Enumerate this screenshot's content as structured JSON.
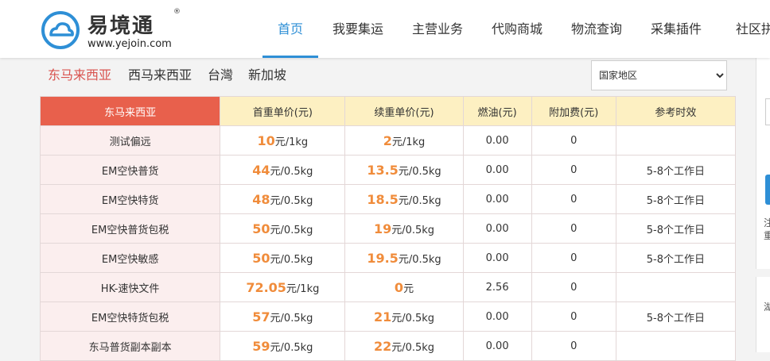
{
  "header": {
    "logo_name": "易境通",
    "logo_reg": "®",
    "logo_url": "www.yejoin.com",
    "nav": [
      {
        "label": "首页",
        "active": true
      },
      {
        "label": "我要集运",
        "active": false
      },
      {
        "label": "主营业务",
        "active": false
      },
      {
        "label": "代购商城",
        "active": false
      },
      {
        "label": "物流查询",
        "active": false
      },
      {
        "label": "采集插件",
        "active": false
      },
      {
        "label": "社区拼团",
        "active": false
      }
    ]
  },
  "regions": {
    "tabs": [
      {
        "label": "东马来西亚",
        "active": true
      },
      {
        "label": "西马来西亚",
        "active": false
      },
      {
        "label": "台灣",
        "active": false
      },
      {
        "label": "新加坡",
        "active": false
      }
    ],
    "select_value": "国家地区"
  },
  "table": {
    "headers": [
      "东马来西亚",
      "首重单价(元)",
      "续重单价(元)",
      "燃油(元)",
      "附加费(元)",
      "参考时效"
    ],
    "rows": [
      {
        "name": "测试偏远",
        "first_price": "10",
        "first_unit": "元/1kg",
        "cont_price": "2",
        "cont_unit": "元/1kg",
        "fuel": "0.00",
        "surcharge": "0",
        "timing": ""
      },
      {
        "name": "EM空快普货",
        "first_price": "44",
        "first_unit": "元/0.5kg",
        "cont_price": "13.5",
        "cont_unit": "元/0.5kg",
        "fuel": "0.00",
        "surcharge": "0",
        "timing": "5-8个工作日"
      },
      {
        "name": "EM空快特货",
        "first_price": "48",
        "first_unit": "元/0.5kg",
        "cont_price": "18.5",
        "cont_unit": "元/0.5kg",
        "fuel": "0.00",
        "surcharge": "0",
        "timing": "5-8个工作日"
      },
      {
        "name": "EM空快普货包税",
        "first_price": "50",
        "first_unit": "元/0.5kg",
        "cont_price": "19",
        "cont_unit": "元/0.5kg",
        "fuel": "0.00",
        "surcharge": "0",
        "timing": "5-8个工作日"
      },
      {
        "name": "EM空快敏感",
        "first_price": "50",
        "first_unit": "元/0.5kg",
        "cont_price": "19.5",
        "cont_unit": "元/0.5kg",
        "fuel": "0.00",
        "surcharge": "0",
        "timing": "5-8个工作日"
      },
      {
        "name": "HK-速快文件",
        "first_price": "72.05",
        "first_unit": "元/1kg",
        "cont_price": "0",
        "cont_unit": "元",
        "fuel": "2.56",
        "surcharge": "0",
        "timing": ""
      },
      {
        "name": "EM空快特货包税",
        "first_price": "57",
        "first_unit": "元/0.5kg",
        "cont_price": "21",
        "cont_unit": "元/0.5kg",
        "fuel": "0.00",
        "surcharge": "0",
        "timing": "5-8个工作日"
      },
      {
        "name": "东马普货副本副本",
        "first_price": "59",
        "first_unit": "元/0.5kg",
        "cont_price": "22",
        "cont_unit": "元/0.5kg",
        "fuel": "0.00",
        "surcharge": "0",
        "timing": ""
      }
    ]
  },
  "right_panel": {
    "text1": "注重",
    "text2": "湖"
  },
  "colors": {
    "accent_blue": "#2e8fd6",
    "header_red": "#e8604c",
    "header_yellow": "#fdf0c2",
    "price_orange": "#f08c3b",
    "active_tab_red": "#d9534f"
  }
}
